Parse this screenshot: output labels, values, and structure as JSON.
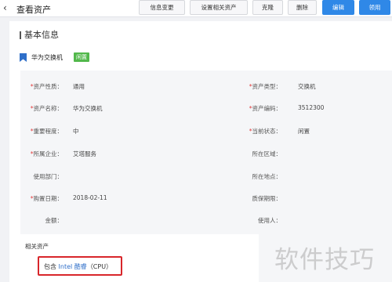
{
  "header": {
    "back_glyph": "‹",
    "title": "查看资产",
    "buttons": [
      {
        "label": "信息变更",
        "style": "default"
      },
      {
        "label": "设置相关资产",
        "style": "default"
      },
      {
        "label": "克隆",
        "style": "default"
      },
      {
        "label": "删除",
        "style": "default"
      },
      {
        "label": "编辑",
        "style": "primary"
      },
      {
        "label": "领用",
        "style": "primary"
      }
    ]
  },
  "section": {
    "title": "基本信息"
  },
  "asset": {
    "name": "华为交换机",
    "status": "闲置",
    "flag_icon": "bookmark-flag-icon",
    "flag_color": "#2f6fc9"
  },
  "fields": {
    "nature": {
      "label": "资产性质：",
      "value": "通用",
      "required": true
    },
    "type": {
      "label": "资产类型：",
      "value": "交换机",
      "required": true
    },
    "name": {
      "label": "资产名称：",
      "value": "华为交换机",
      "required": true
    },
    "code": {
      "label": "资产编码：",
      "value": "3512300",
      "required": true
    },
    "importance": {
      "label": "重要程度：",
      "value": "中",
      "required": true
    },
    "state": {
      "label": "当前状态：",
      "value": "闲置",
      "required": true
    },
    "company": {
      "label": "所属企业：",
      "value": "艾塔服务",
      "required": true
    },
    "area": {
      "label": "所在区域：",
      "value": "",
      "required": false
    },
    "department": {
      "label": "使用部门：",
      "value": "",
      "required": false
    },
    "location": {
      "label": "所在地点：",
      "value": "",
      "required": false
    },
    "purchase_date": {
      "label": "购置日期：",
      "value": "2018-02-11",
      "required": true
    },
    "warranty": {
      "label": "质保期限：",
      "value": "",
      "required": false
    },
    "amount": {
      "label": "金额：",
      "value": "",
      "required": false
    },
    "user": {
      "label": "使用人：",
      "value": "",
      "required": false
    }
  },
  "required_mark": "*",
  "related": {
    "title": "相关资产",
    "prefix": "包含",
    "link_text": "Intel 酷睿",
    "suffix": "（CPU）"
  },
  "watermark": "软件技巧",
  "colors": {
    "primary": "#2f88e7",
    "status_green": "#52b84b",
    "highlight_red": "#d8262b",
    "link_blue": "#2f6fc9"
  }
}
